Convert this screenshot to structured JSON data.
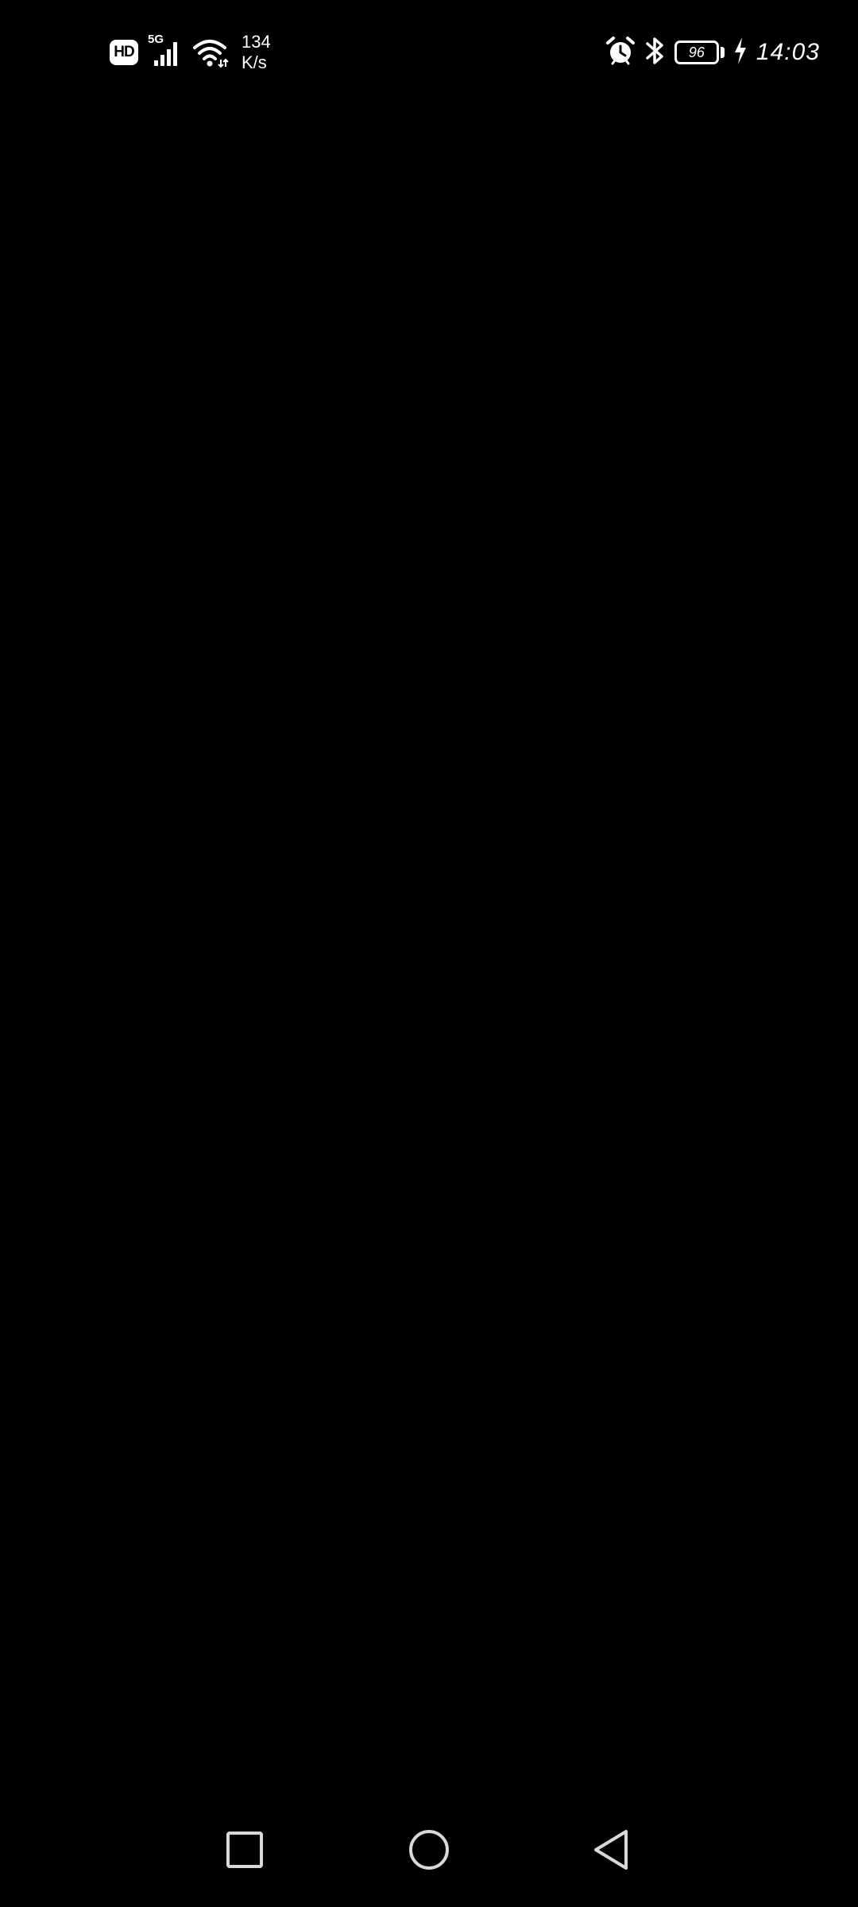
{
  "status_bar": {
    "left_badge": "HD",
    "network_type": "5G",
    "net_speed_value": "134",
    "net_speed_unit": "K/s",
    "battery_level": "96",
    "time": "14:03",
    "icons": [
      "hd-icon",
      "cellular-signal-icon",
      "wifi-icon",
      "alarm-icon",
      "bluetooth-icon",
      "battery-icon",
      "charging-icon"
    ]
  },
  "navigation_bar": {
    "buttons": [
      "recents-button",
      "home-button",
      "back-button"
    ]
  },
  "colors": {
    "background": "#000000",
    "foreground": "#ffffff",
    "nav_icon": "#d9d9d9"
  }
}
